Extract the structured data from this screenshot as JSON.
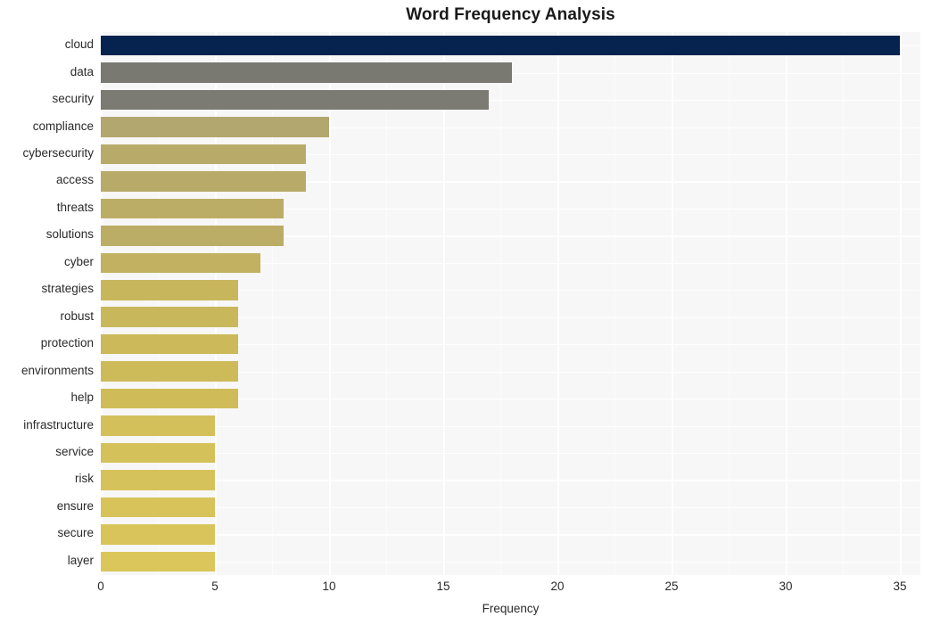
{
  "chart_data": {
    "type": "bar",
    "orientation": "horizontal",
    "title": "Word Frequency Analysis",
    "xlabel": "Frequency",
    "ylabel": "",
    "categories": [
      "cloud",
      "data",
      "security",
      "compliance",
      "cybersecurity",
      "access",
      "threats",
      "solutions",
      "cyber",
      "strategies",
      "robust",
      "protection",
      "environments",
      "help",
      "infrastructure",
      "service",
      "risk",
      "ensure",
      "secure",
      "layer"
    ],
    "values": [
      35,
      18,
      17,
      10,
      9,
      9,
      8,
      8,
      7,
      6,
      6,
      6,
      6,
      6,
      5,
      5,
      5,
      5,
      5,
      5
    ],
    "bar_colors": [
      "#062350",
      "#797972",
      "#7b7b74",
      "#b2a76e",
      "#b8ab69",
      "#b8ab69",
      "#bcad66",
      "#bcad66",
      "#c2b161",
      "#c8b65c",
      "#c9b85b",
      "#cbb95a",
      "#cdbb59",
      "#cfbc58",
      "#d4c05a",
      "#d5c15a",
      "#d6c25a",
      "#d7c35a",
      "#d8c45a",
      "#dac65b"
    ],
    "xlim": [
      0,
      35.9
    ],
    "xticks": [
      0,
      5,
      10,
      15,
      20,
      25,
      30,
      35
    ],
    "xtick_labels": [
      "0",
      "5",
      "10",
      "15",
      "20",
      "25",
      "30",
      "35"
    ],
    "x_minor_ticks": [
      2.5,
      7.5,
      12.5,
      17.5,
      22.5,
      27.5,
      32.5
    ],
    "grid": true,
    "grid_color": "#ffffff",
    "plot_background": "#f7f7f7",
    "figure_background": "#ffffff",
    "legend": null
  }
}
